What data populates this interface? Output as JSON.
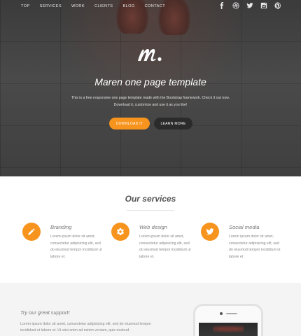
{
  "nav": {
    "items": [
      "TOP",
      "SERVICES",
      "WORK",
      "CLIENTS",
      "BLOG",
      "CONTACT"
    ],
    "social_icons": [
      "facebook-icon",
      "dribbble-icon",
      "twitter-icon",
      "instagram-icon",
      "pinterest-icon"
    ]
  },
  "hero": {
    "logo_text": "m.",
    "title": "Maren one page template",
    "desc_line1": "This is a free responsive one page template made with the Bootstrap framework. Check it out now.",
    "desc_line2": "Download it, customize and use it as you like!",
    "download_label": "DOWNLOAD IT",
    "learn_label": "LEARN MORE"
  },
  "services": {
    "title": "Our services",
    "items": [
      {
        "title": "Branding",
        "text": "Lorem ipsum dolor sit amet, consectetur adipisicing elit, sed do eiusmod tempor incididunt ut labore et.",
        "icon": "pencil-icon"
      },
      {
        "title": "Web design",
        "text": "Lorem ipsum dolor sit amet, consectetur adipisicing elit, sed do eiusmod tempor incididunt ut labore et.",
        "icon": "gear-icon"
      },
      {
        "title": "Social media",
        "text": "Lorem ipsum dolor sit amet, consectetur adipisicing elit, sed do eiusmod tempor incididunt ut labore et.",
        "icon": "twitter-icon"
      }
    ]
  },
  "support": {
    "title": "Try our great support!",
    "text": "Lorem ipsum dolor sit amet, consectetur adipisicing elit, sed do eiusmod tempor incididunt ut labore et. Ut wisi enim ad minim veniam, quis nostrud."
  },
  "colors": {
    "accent": "#f7941d",
    "dark_button": "#2b2b2b",
    "support_bg": "#f4f4f4"
  }
}
